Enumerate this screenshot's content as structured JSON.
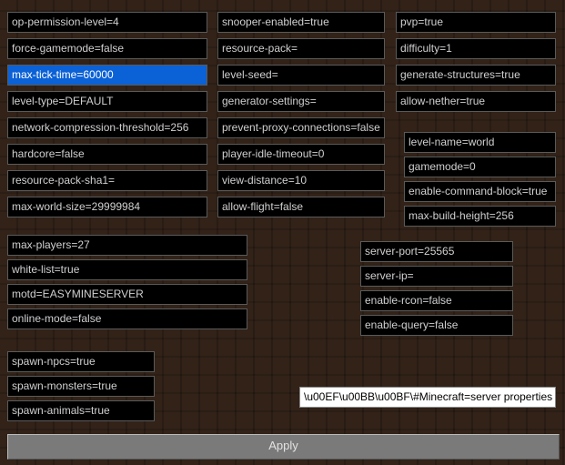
{
  "col1": [
    "op-permission-level=4",
    "force-gamemode=false",
    "max-tick-time=60000",
    "level-type=DEFAULT",
    "network-compression-threshold=256",
    "hardcore=false",
    "resource-pack-sha1=",
    "max-world-size=29999984"
  ],
  "col1_selected_index": 2,
  "col2": [
    "snooper-enabled=true",
    "resource-pack=",
    "level-seed=",
    "generator-settings=",
    "prevent-proxy-connections=false",
    "player-idle-timeout=0",
    "view-distance=10",
    "allow-flight=false"
  ],
  "col3": [
    "pvp=true",
    "difficulty=1",
    "generate-structures=true",
    "allow-nether=true"
  ],
  "col4": [
    "level-name=world",
    "gamemode=0",
    "enable-command-block=true",
    "max-build-height=256"
  ],
  "group_players": [
    "max-players=27",
    "white-list=true",
    "motd=EASYMINESERVER",
    "online-mode=false"
  ],
  "group_net": [
    "server-port=25565",
    "server-ip=",
    "enable-rcon=false",
    "enable-query=false"
  ],
  "group_spawn": [
    "spawn-npcs=true",
    "spawn-monsters=true",
    "spawn-animals=true"
  ],
  "footer_input": "\\u00EF\\u00BB\\u00BF\\#Minecraft=server properties",
  "apply_label": "Apply"
}
